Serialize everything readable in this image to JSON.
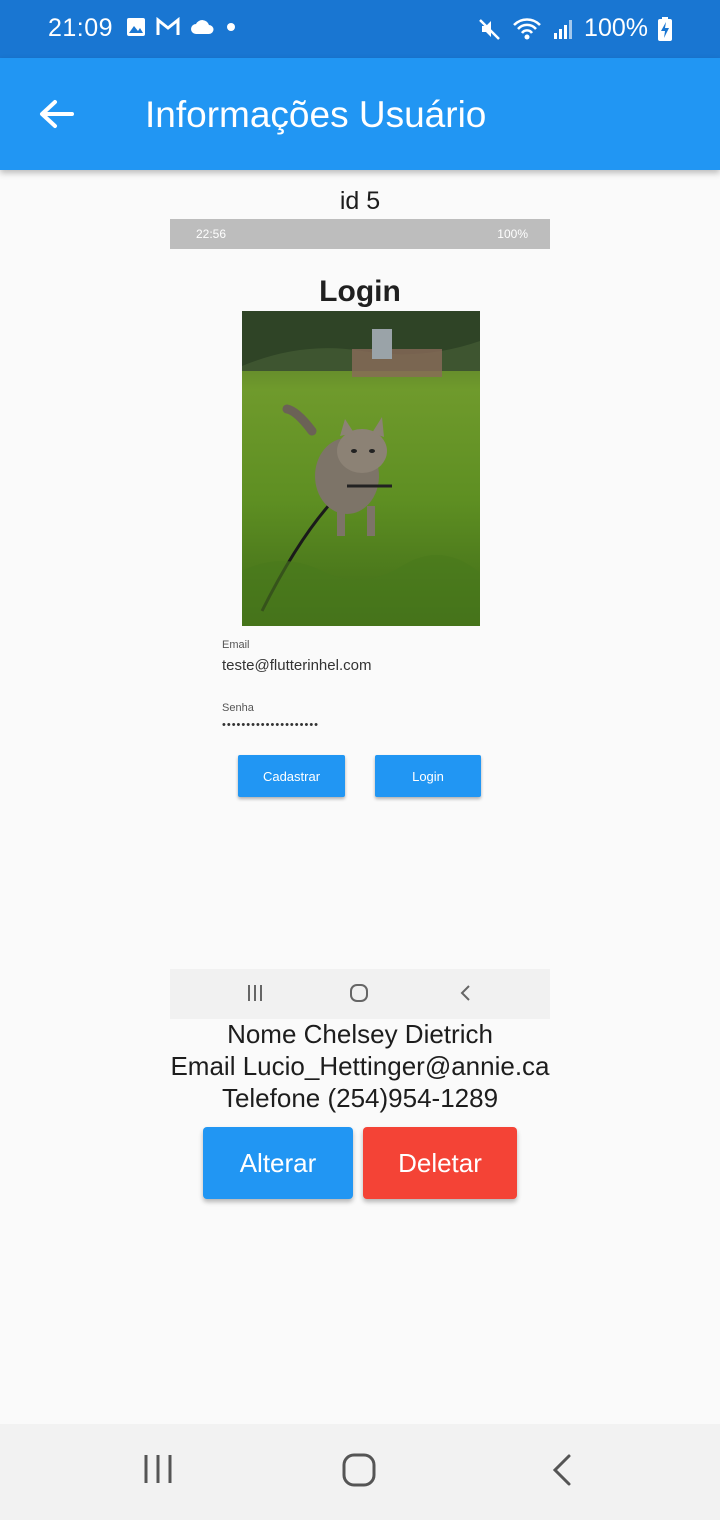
{
  "status_bar": {
    "time": "21:09",
    "battery": "100%"
  },
  "app_bar": {
    "title": "Informações Usuário"
  },
  "user": {
    "id_line": "id 5",
    "nome_line": "Nome Chelsey Dietrich",
    "email_line": "Email Lucio_Hettinger@annie.ca",
    "telefone_line": "Telefone (254)954-1289"
  },
  "photo": {
    "status_time": "22:56",
    "status_battery": "100%",
    "login_title": "Login",
    "email_label": "Email",
    "email_value": "teste@flutterinhel.com",
    "senha_label": "Senha",
    "senha_value": "••••••••••••••••••••",
    "cadastrar_label": "Cadastrar",
    "login_label": "Login"
  },
  "actions": {
    "alterar": "Alterar",
    "deletar": "Deletar"
  },
  "colors": {
    "status_bar": "#1976d2",
    "app_bar": "#2196f3",
    "primary_button": "#2196f3",
    "delete_button": "#f44336"
  }
}
